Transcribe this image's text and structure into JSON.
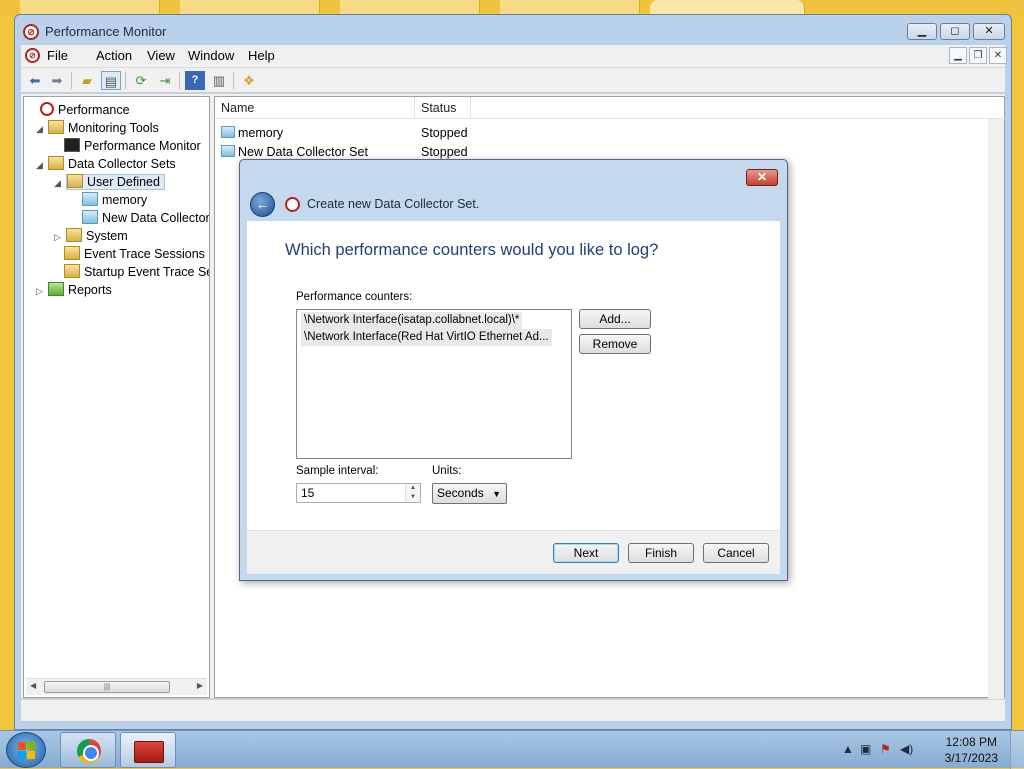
{
  "window": {
    "title": "Performance Monitor",
    "controls": {
      "minimize": "▭",
      "maximize": "◻",
      "close": "✕"
    }
  },
  "menu": {
    "items": [
      "File",
      "Action",
      "View",
      "Window",
      "Help"
    ]
  },
  "tree": {
    "items": [
      {
        "label": "Performance",
        "icon": "performance-icon",
        "arrow": ""
      },
      {
        "label": "Monitoring Tools",
        "icon": "folder-icon",
        "arrow": "◢"
      },
      {
        "label": "Performance Monitor",
        "icon": "monitor-icon",
        "arrow": ""
      },
      {
        "label": "Data Collector Sets",
        "icon": "folder-icon",
        "arrow": "◢"
      },
      {
        "label": "User Defined",
        "icon": "user-folder-icon",
        "arrow": "◢"
      },
      {
        "label": "memory",
        "icon": "collector-set-icon",
        "arrow": ""
      },
      {
        "label": "New Data Collector",
        "icon": "collector-set-icon",
        "arrow": ""
      },
      {
        "label": "System",
        "icon": "folder-icon",
        "arrow": "▷"
      },
      {
        "label": "Event Trace Sessions",
        "icon": "folder-icon",
        "arrow": ""
      },
      {
        "label": "Startup Event Trace Ses",
        "icon": "folder-icon",
        "arrow": ""
      },
      {
        "label": "Reports",
        "icon": "report-icon",
        "arrow": "▷"
      }
    ],
    "selected": "User Defined"
  },
  "list": {
    "columns": [
      "Name",
      "Status"
    ],
    "rows": [
      {
        "name": "memory",
        "status": "Stopped"
      },
      {
        "name": "New Data Collector Set",
        "status": "Stopped"
      }
    ]
  },
  "wizard": {
    "title": "Create new Data Collector Set.",
    "question": "Which performance counters would you like to log?",
    "counters_label": "Performance counters:",
    "counters": [
      "\\Network Interface(isatap.collabnet.local)\\*",
      "\\Network Interface(Red Hat VirtIO Ethernet Ad..."
    ],
    "add_label": "Add...",
    "remove_label": "Remove",
    "interval_label": "Sample interval:",
    "interval_value": "15",
    "units_label": "Units:",
    "units_value": "Seconds",
    "next_label": "Next",
    "finish_label": "Finish",
    "cancel_label": "Cancel"
  },
  "taskbar": {
    "time": "12:08 PM",
    "date": "3/17/2023"
  }
}
